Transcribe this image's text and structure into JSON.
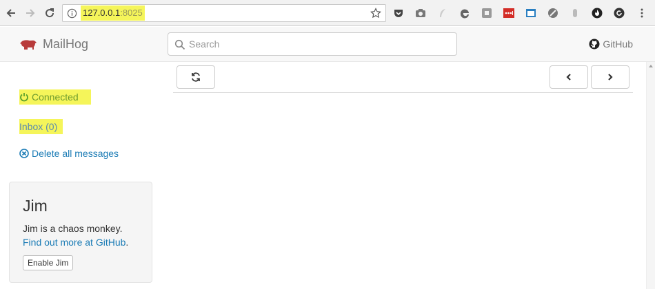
{
  "browser": {
    "url_host": "127.0.0.1",
    "url_port": ":8025",
    "extension_icons": [
      "pocket-icon",
      "camera-icon",
      "feather-icon",
      "edge-icon",
      "puzzle-icon",
      "lastpass-icon",
      "screen-icon",
      "slash-icon",
      "mouse-icon",
      "fire-icon",
      "refresh-circle-icon"
    ]
  },
  "navbar": {
    "brand": "MailHog",
    "search_placeholder": "Search",
    "github_label": "GitHub"
  },
  "sidebar": {
    "connected": "Connected",
    "inbox": "Inbox (0)",
    "delete_all": "Delete all messages"
  },
  "jim": {
    "title": "Jim",
    "description": "Jim is a chaos monkey.",
    "more_link": "Find out more at GitHub",
    "more_suffix": ".",
    "enable_button": "Enable Jim"
  },
  "colors": {
    "highlight": "#f5f55a",
    "link": "#1a7bb5",
    "brand_red": "#b83b3b"
  }
}
